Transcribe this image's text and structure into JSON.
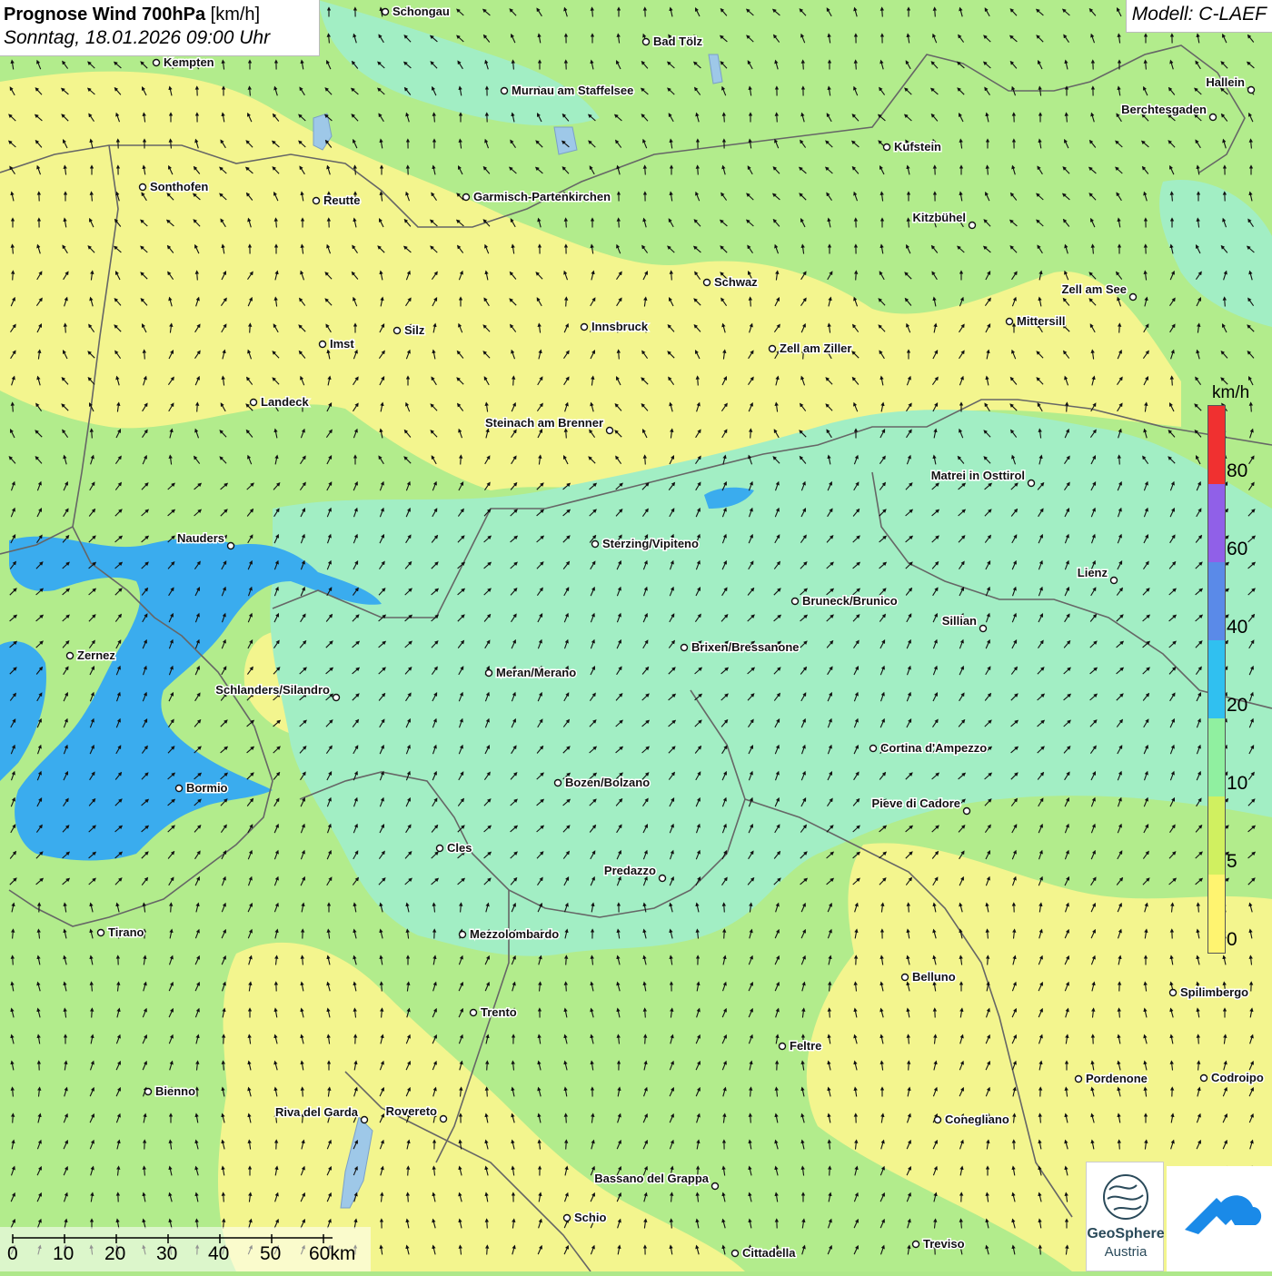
{
  "title": {
    "main_bold": "Prognose Wind 700hPa",
    "main_unit": " [km/h]",
    "date": "Sonntag, 18.01.2026 09:00 Uhr"
  },
  "model": "Modell: C-LAEF",
  "legend": {
    "unit": "km/h",
    "labels": [
      "80",
      "60",
      "40",
      "20",
      "10",
      "5",
      "0"
    ],
    "colors": [
      "#f03030",
      "#9060e8",
      "#5a8ae8",
      "#30c0f0",
      "#90f0a0",
      "#d0f060",
      "#fff470"
    ]
  },
  "map_colors": {
    "yellow": "#f3f58e",
    "green": "#b2ec8c",
    "cyan": "#a2eec4",
    "blue": "#3aacee",
    "border": "#666666"
  },
  "cities": [
    {
      "name": "Schongau",
      "side": "right"
    },
    {
      "name": "Bad Tölz",
      "side": "right"
    },
    {
      "name": "Kempten",
      "side": "right"
    },
    {
      "name": "Murnau am Staffelsee",
      "side": "right"
    },
    {
      "name": "Hallein",
      "side": "left"
    },
    {
      "name": "Berchtesgaden",
      "side": "left"
    },
    {
      "name": "Kufstein",
      "side": "right"
    },
    {
      "name": "Sonthofen",
      "side": "right"
    },
    {
      "name": "Reutte",
      "side": "right"
    },
    {
      "name": "Garmisch-Partenkirchen",
      "side": "right"
    },
    {
      "name": "Kitzbühel",
      "side": "left"
    },
    {
      "name": "Schwaz",
      "side": "right"
    },
    {
      "name": "Zell am See",
      "side": "left"
    },
    {
      "name": "Mittersill",
      "side": "right"
    },
    {
      "name": "Innsbruck",
      "side": "right"
    },
    {
      "name": "Silz",
      "side": "right"
    },
    {
      "name": "Imst",
      "side": "right"
    },
    {
      "name": "Zell am Ziller",
      "side": "right"
    },
    {
      "name": "Landeck",
      "side": "right"
    },
    {
      "name": "Steinach am Brenner",
      "side": "left"
    },
    {
      "name": "Matrei in Osttirol",
      "side": "left"
    },
    {
      "name": "Nauders",
      "side": "left"
    },
    {
      "name": "Sterzing/Vipiteno",
      "side": "right"
    },
    {
      "name": "Lienz",
      "side": "left"
    },
    {
      "name": "Bruneck/Brunico",
      "side": "right"
    },
    {
      "name": "Sillian",
      "side": "left"
    },
    {
      "name": "Zernez",
      "side": "right"
    },
    {
      "name": "Brixen/Bressanone",
      "side": "right"
    },
    {
      "name": "Meran/Merano",
      "side": "right"
    },
    {
      "name": "Schlanders/Silandro",
      "side": "left"
    },
    {
      "name": "Cortina d'Ampezzo",
      "side": "right"
    },
    {
      "name": "Bozen/Bolzano",
      "side": "right"
    },
    {
      "name": "Bormio",
      "side": "right"
    },
    {
      "name": "Pieve di Cadore",
      "side": "left"
    },
    {
      "name": "Cles",
      "side": "right"
    },
    {
      "name": "Predazzo",
      "side": "left"
    },
    {
      "name": "Tirano",
      "side": "right"
    },
    {
      "name": "Mezzolombardo",
      "side": "right"
    },
    {
      "name": "Belluno",
      "side": "right"
    },
    {
      "name": "Spilimbergo",
      "side": "right"
    },
    {
      "name": "Trento",
      "side": "right"
    },
    {
      "name": "Feltre",
      "side": "right"
    },
    {
      "name": "Pordenone",
      "side": "right"
    },
    {
      "name": "Codroipo",
      "side": "right"
    },
    {
      "name": "Bienno",
      "side": "right"
    },
    {
      "name": "Riva del Garda",
      "side": "left"
    },
    {
      "name": "Rovereto",
      "side": "left"
    },
    {
      "name": "Conegliano",
      "side": "right"
    },
    {
      "name": "Bassano del Grappa",
      "side": "left"
    },
    {
      "name": "Schio",
      "side": "right"
    },
    {
      "name": "Treviso",
      "side": "right"
    },
    {
      "name": "Cittadella",
      "side": "right"
    }
  ],
  "scale": {
    "labels": [
      "0",
      "10",
      "20",
      "30",
      "40",
      "50",
      "60km"
    ]
  },
  "logo": {
    "name": "GeoSphere",
    "country": "Austria"
  }
}
